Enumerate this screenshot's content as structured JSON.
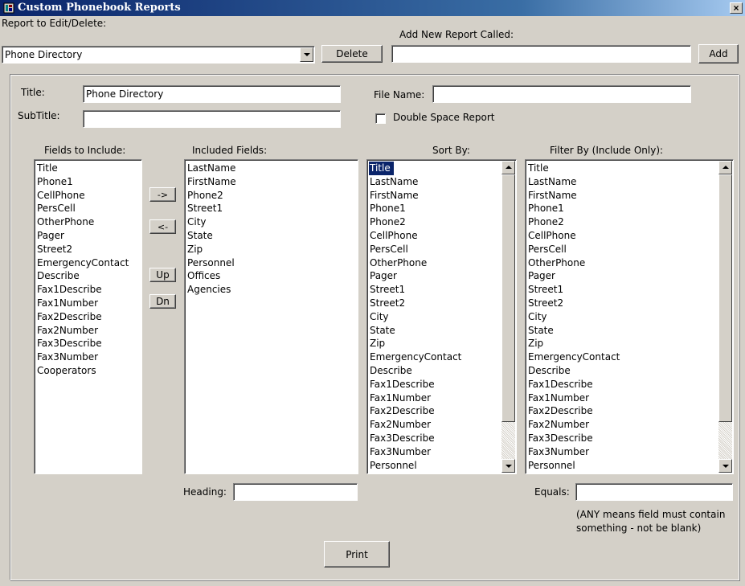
{
  "window": {
    "title": "Custom Phonebook Reports",
    "close_label": "×"
  },
  "top": {
    "report_label": "Report to Edit/Delete:",
    "report_value": "Phone Directory",
    "delete_label": "Delete",
    "add_new_label": "Add New Report Called:",
    "add_new_value": "",
    "add_label": "Add"
  },
  "form": {
    "title_label": "Title:",
    "title_value": "Phone Directory",
    "subtitle_label": "SubTitle:",
    "subtitle_value": "",
    "filename_label": "File Name:",
    "filename_value": "",
    "double_space_label": "Double Space Report"
  },
  "lists": {
    "fields_to_include": {
      "label": "Fields to Include:",
      "items": [
        "Title",
        "Phone1",
        "CellPhone",
        "PersCell",
        "OtherPhone",
        "Pager",
        "Street2",
        "EmergencyContact",
        "Describe",
        "Fax1Describe",
        "Fax1Number",
        "Fax2Describe",
        "Fax2Number",
        "Fax3Describe",
        "Fax3Number",
        "Cooperators"
      ]
    },
    "included_fields": {
      "label": "Included Fields:",
      "items": [
        "LastName",
        "FirstName",
        "Phone2",
        "Street1",
        "City",
        "State",
        "Zip",
        "Personnel",
        "Offices",
        "Agencies"
      ]
    },
    "sort_by": {
      "label": "Sort By:",
      "selected": "Title",
      "items": [
        "Title",
        "LastName",
        "FirstName",
        "Phone1",
        "Phone2",
        "CellPhone",
        "PersCell",
        "OtherPhone",
        "Pager",
        "Street1",
        "Street2",
        "City",
        "State",
        "Zip",
        "EmergencyContact",
        "Describe",
        "Fax1Describe",
        "Fax1Number",
        "Fax2Describe",
        "Fax2Number",
        "Fax3Describe",
        "Fax3Number",
        "Personnel"
      ]
    },
    "filter_by": {
      "label": "Filter By (Include Only):",
      "items": [
        "Title",
        "LastName",
        "FirstName",
        "Phone1",
        "Phone2",
        "CellPhone",
        "PersCell",
        "OtherPhone",
        "Pager",
        "Street1",
        "Street2",
        "City",
        "State",
        "Zip",
        "EmergencyContact",
        "Describe",
        "Fax1Describe",
        "Fax1Number",
        "Fax2Describe",
        "Fax2Number",
        "Fax3Describe",
        "Fax3Number",
        "Personnel"
      ]
    }
  },
  "move_buttons": {
    "right": "->",
    "left": "<-",
    "up": "Up",
    "down": "Dn"
  },
  "heading": {
    "label": "Heading:",
    "value": ""
  },
  "equals": {
    "label": "Equals:",
    "value": "",
    "note_line1": "(ANY means field must contain",
    "note_line2": "something - not be blank)"
  },
  "print_label": "Print",
  "colors": {
    "titlebar": "#0a246a",
    "face": "#d4d0c8",
    "selection": "#0a246a"
  }
}
